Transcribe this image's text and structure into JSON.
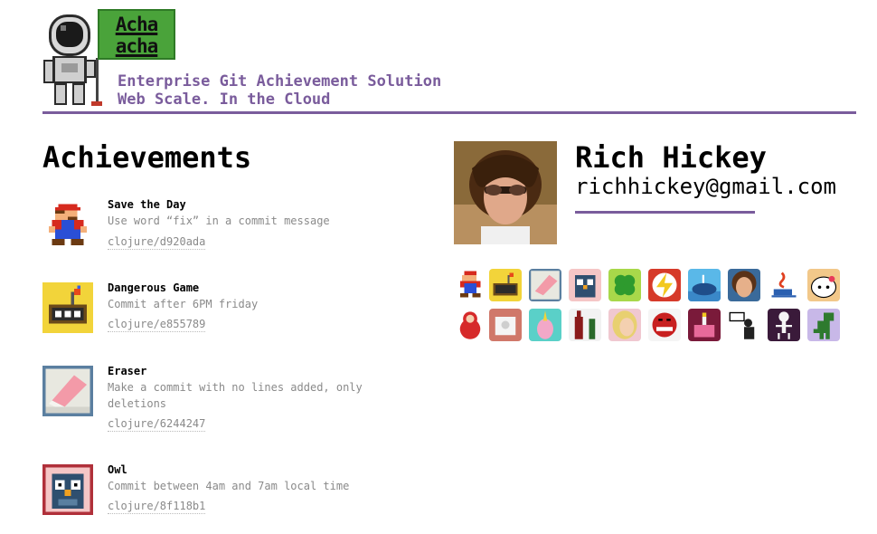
{
  "header": {
    "logo_line1": "Acha",
    "logo_line2": "acha",
    "tagline1": "Enterprise Git Achievement Solution",
    "tagline2": "Web Scale. In the Cloud",
    "accent_color": "#7a5c9c",
    "logo_color": "#4aa33a"
  },
  "achievements": {
    "title": "Achievements",
    "items": [
      {
        "name": "Save the Day",
        "description": "Use word “fix” in a commit message",
        "commit": "clojure/d920ada",
        "icon": "mario-icon"
      },
      {
        "name": "Dangerous Game",
        "description": "Commit after 6PM friday",
        "commit": "clojure/e855789",
        "icon": "bomb-icon"
      },
      {
        "name": "Eraser",
        "description": "Make a commit with no lines added, only deletions",
        "commit": "clojure/6244247",
        "icon": "eraser-icon"
      },
      {
        "name": "Owl",
        "description": "Commit between 4am and 7am local time",
        "commit": "clojure/8f118b1",
        "icon": "owl-icon"
      }
    ]
  },
  "profile": {
    "name": "Rich Hickey",
    "email": "richhickey@gmail.com"
  },
  "badges": [
    "mario-icon",
    "bomb-icon",
    "eraser-icon",
    "owl-icon",
    "clover-icon",
    "lightning-icon",
    "whale-icon",
    "face-icon",
    "java-cup-icon",
    "hello-kitty-icon",
    "matryoshka-icon",
    "toilet-paper-icon",
    "unicorn-icon",
    "bottles-icon",
    "blonde-icon",
    "devil-face-icon",
    "birthday-cake-icon",
    "presenter-icon",
    "skeleton-icon",
    "dinosaur-icon"
  ]
}
